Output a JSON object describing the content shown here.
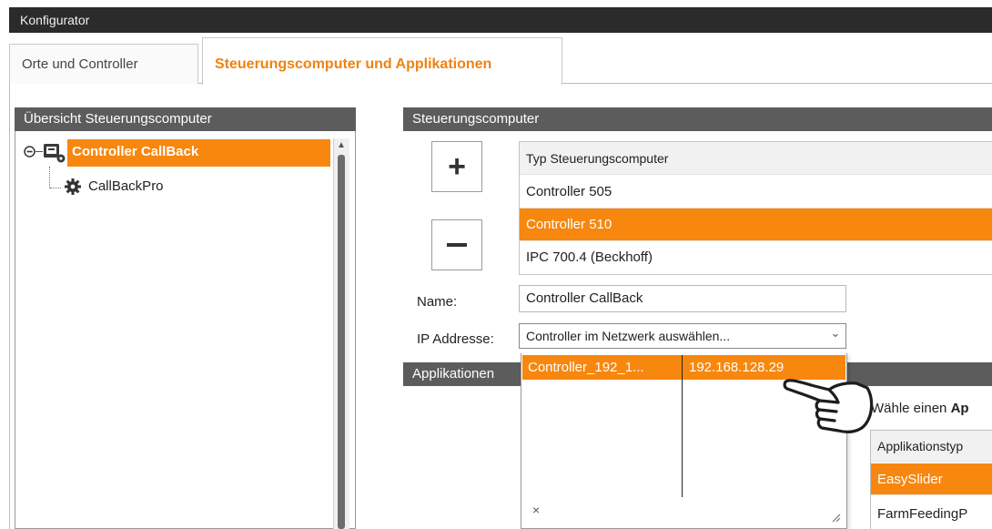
{
  "window": {
    "title": "Konfigurator"
  },
  "tabs": [
    {
      "label": "Orte und Controller",
      "active": false
    },
    {
      "label": "Steuerungscomputer und Applikationen",
      "active": true
    }
  ],
  "overview": {
    "header": "Übersicht Steuerungscomputer",
    "tree": [
      {
        "label": "Controller CallBack",
        "icon": "controller-icon",
        "selected": true
      },
      {
        "label": "CallBackPro",
        "icon": "gear-icon",
        "selected": false
      }
    ]
  },
  "computer": {
    "header": "Steuerungscomputer",
    "add_symbol": "+",
    "remove_symbol": "—",
    "list_header": "Typ Steuerungscomputer",
    "types": [
      {
        "label": "Controller 505",
        "selected": false
      },
      {
        "label": "Controller 510",
        "selected": true
      },
      {
        "label": "IPC 700.4 (Beckhoff)",
        "selected": false
      }
    ],
    "name_label": "Name:",
    "name_value": "Controller CallBack",
    "ip_label": "IP Addresse:",
    "ip_placeholder": "Controller im Netzwerk auswählen...",
    "ip_chevron": "⌄",
    "dropdown": {
      "name": "Controller_192_1...",
      "ip": "192.168.128.29",
      "clear_symbol": "×"
    }
  },
  "applications": {
    "header": "Applikationen",
    "prompt_prefix": "Wähle einen ",
    "prompt_bold": "Ap",
    "list_header": "Applikationstyp",
    "items": [
      {
        "label": "EasySlider",
        "selected": true
      },
      {
        "label": "FarmFeedingP",
        "selected": false
      }
    ]
  },
  "colors": {
    "accent": "#f7870f",
    "header_bg": "#5c5c5c",
    "title_bg": "#2b2b2b"
  }
}
